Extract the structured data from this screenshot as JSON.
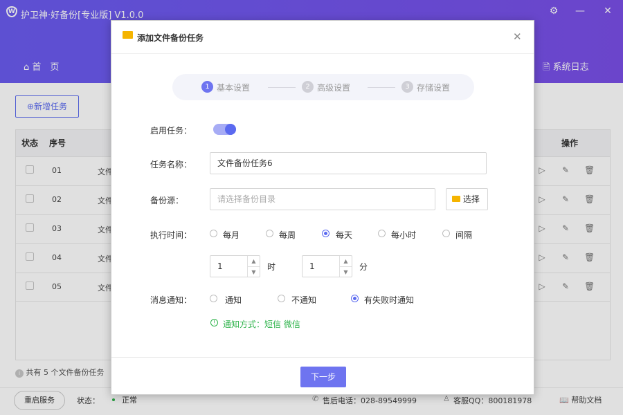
{
  "app": {
    "title": "护卫神·好备份[专业版]  V1.0.0",
    "window_buttons": {
      "settings_icon": "gear-icon",
      "minimize": "—",
      "close": "✕"
    }
  },
  "nav": {
    "home": "首　页",
    "syslog": "系统日志"
  },
  "toolbar": {
    "add_task": "新增任务"
  },
  "table": {
    "headers": {
      "status": "状态",
      "index": "序号",
      "actions": "操作"
    },
    "rows": [
      {
        "index": "01",
        "name": "文件"
      },
      {
        "index": "02",
        "name": "文件"
      },
      {
        "index": "03",
        "name": "文件"
      },
      {
        "index": "04",
        "name": "文件"
      },
      {
        "index": "05",
        "name": "文件"
      }
    ],
    "summary": "共有 5 个文件备份任务"
  },
  "footer": {
    "restart": "重启服务",
    "status_label": "状态：",
    "status_value": "正常",
    "phone": "售后电话：028-89549999",
    "qq": "客服QQ：800181978",
    "help": "帮助文档"
  },
  "dialog": {
    "title": "添加文件备份任务",
    "steps": [
      {
        "num": "1",
        "label": "基本设置",
        "active": true
      },
      {
        "num": "2",
        "label": "高级设置",
        "active": false
      },
      {
        "num": "3",
        "label": "存储设置",
        "active": false
      }
    ],
    "enable_label": "启用任务：",
    "enable_on": true,
    "task_name_label": "任务名称：",
    "task_name_value": "文件备份任务6",
    "source_label": "备份源：",
    "source_placeholder": "请选择备份目录",
    "select_button": "选择",
    "exec_time_label": "执行时间：",
    "exec_options": [
      {
        "label": "每月",
        "checked": false
      },
      {
        "label": "每周",
        "checked": false
      },
      {
        "label": "每天",
        "checked": true
      },
      {
        "label": "每小时",
        "checked": false
      },
      {
        "label": "间隔",
        "checked": false
      }
    ],
    "hour_value": "1",
    "hour_unit": "时",
    "minute_value": "1",
    "minute_unit": "分",
    "notify_label": "消息通知：",
    "notify_options": [
      {
        "label": "通知",
        "checked": false
      },
      {
        "label": "不通知",
        "checked": false
      },
      {
        "label": "有失败时通知",
        "checked": true
      }
    ],
    "notify_method": "通知方式：短信 微信",
    "next_button": "下一步"
  },
  "colors": {
    "accent": "#5b6af0",
    "header": "#6a5cf0",
    "success": "#2db34a"
  }
}
